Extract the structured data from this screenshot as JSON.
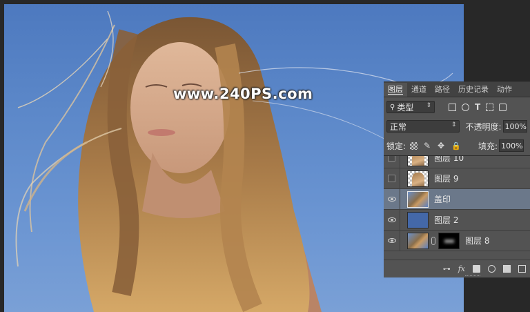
{
  "watermark": "www.240PS.com",
  "panel": {
    "tabs": [
      {
        "label": "图层",
        "active": true
      },
      {
        "label": "通道",
        "active": false
      },
      {
        "label": "路径",
        "active": false
      },
      {
        "label": "历史记录",
        "active": false
      },
      {
        "label": "动作",
        "active": false
      }
    ],
    "filter": {
      "kind_label": "类型",
      "icons": [
        "image-filter-icon",
        "adjustment-filter-icon",
        "type-filter-icon",
        "shape-filter-icon",
        "smart-object-filter-icon"
      ]
    },
    "blend_mode": "正常",
    "opacity_label": "不透明度:",
    "opacity_value": "100%",
    "lock_label": "锁定:",
    "lock_icons": [
      "lock-transparent-icon",
      "lock-image-icon",
      "lock-position-icon",
      "lock-all-icon"
    ],
    "fill_label": "填充:",
    "fill_value": "100%",
    "layers": [
      {
        "name": "图层 10",
        "visible": false,
        "thumb": "photo-trans",
        "selected": false,
        "mask": false
      },
      {
        "name": "图层 9",
        "visible": false,
        "thumb": "photo-trans",
        "selected": false,
        "mask": false
      },
      {
        "name": "盖印",
        "visible": true,
        "thumb": "photo",
        "selected": true,
        "mask": false
      },
      {
        "name": "图层 2",
        "visible": true,
        "thumb": "solid",
        "selected": false,
        "mask": false
      },
      {
        "name": "图层 8",
        "visible": true,
        "thumb": "photo",
        "selected": false,
        "mask": true
      }
    ],
    "bottom_icons": [
      "link-icon",
      "fx-icon",
      "mask-icon",
      "adjustment-icon",
      "folder-icon",
      "new-layer-icon"
    ],
    "fx_label": "fx"
  }
}
